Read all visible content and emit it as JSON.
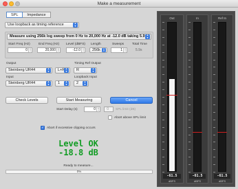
{
  "window": {
    "title": "Make a measurement"
  },
  "tabs": [
    {
      "label": "SPL",
      "active": true
    },
    {
      "label": "Impedance",
      "active": false
    }
  ],
  "timing_reference": {
    "value": "Use loopback as timing reference"
  },
  "sweep": {
    "description": "Measure using 256k log sweep from 0 Hz to 20,000 Hz at -12.0 dB taking 5.9 s",
    "fields": {
      "start_freq_label": "Start Freq (Hz)",
      "start_freq_value": "0",
      "end_freq_label": "End Freq (Hz)",
      "end_freq_value": "20,000",
      "level_label": "Level (dBFS)",
      "level_value": "-12.0",
      "length_label": "Length",
      "length_value": "256k",
      "sweeps_label": "Sweeps",
      "sweeps_value": "1",
      "total_time_label": "Total Time",
      "total_time_value": "5.9s"
    }
  },
  "output": {
    "label": "Output",
    "device": "Steinberg UR44",
    "channel": "L+R",
    "timing_ref_label": "Timing Ref Output",
    "timing_ref_value": "R"
  },
  "input": {
    "label": "Input",
    "device": "Steinberg UR44",
    "channel": "1",
    "loopback_label": "Loopback Input",
    "loopback_value": "2"
  },
  "buttons": {
    "check_levels": "Check Levels",
    "start_measuring": "Start Measuring",
    "cancel": "Cancel"
  },
  "start_delay": {
    "label": "Start Delay (s)",
    "value": "0"
  },
  "spl_limit": {
    "label": "SPL limit (dB)",
    "value": "0"
  },
  "abort_spl": {
    "label": "Abort above SPL limit",
    "checked": false
  },
  "abort_clipping": {
    "label": "Abort if excessive clipping occurs",
    "checked": true
  },
  "status": {
    "line1": "Level OK",
    "line2": "-18.8 dB",
    "message": "Ready to measure...",
    "progress_text": "0%",
    "progress": 0
  },
  "meters": [
    {
      "name": "Out",
      "value": "-61.5",
      "unit": "dBFS",
      "fill": 0.62,
      "marker": 0.51
    },
    {
      "name": "In",
      "value": "-61.5",
      "unit": "dBFS",
      "fill": 0.0,
      "marker": 0.26
    },
    {
      "name": "Ref In",
      "value": "-61.5",
      "unit": "dBFS",
      "fill": 0.0,
      "marker": 0.26
    }
  ],
  "colors": {
    "accent": "#3a7be0",
    "status_ok": "#119c23",
    "meter_marker": "#d02020"
  }
}
